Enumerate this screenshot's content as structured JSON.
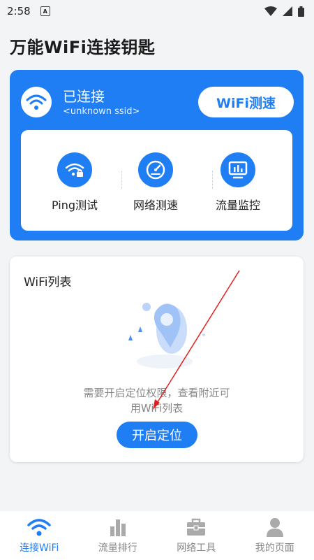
{
  "status_bar": {
    "time": "2:58",
    "notif_letter": "A"
  },
  "app": {
    "title": "万能WiFi连接钥匙"
  },
  "wifi_card": {
    "status": "已连接",
    "ssid": "<unknown ssid>",
    "speed_button": "WiFi测速",
    "tools": [
      {
        "label": "Ping测试",
        "icon": "wifi-lock-icon"
      },
      {
        "label": "网络测速",
        "icon": "speedometer-icon"
      },
      {
        "label": "流量监控",
        "icon": "monitor-chart-icon"
      }
    ]
  },
  "wifi_list": {
    "title": "WiFi列表",
    "permission_line1": "需要开启定位权限，查看附近可",
    "permission_line2": "用WiFi列表",
    "button": "开启定位"
  },
  "bottom_nav": [
    {
      "label": "连接WiFi",
      "icon": "wifi-icon",
      "active": true
    },
    {
      "label": "流量排行",
      "icon": "bar-chart-icon",
      "active": false
    },
    {
      "label": "网络工具",
      "icon": "toolbox-icon",
      "active": false
    },
    {
      "label": "我的页面",
      "icon": "user-icon",
      "active": false
    }
  ],
  "colors": {
    "accent": "#1f7ef3",
    "annotation": "#e02020"
  }
}
